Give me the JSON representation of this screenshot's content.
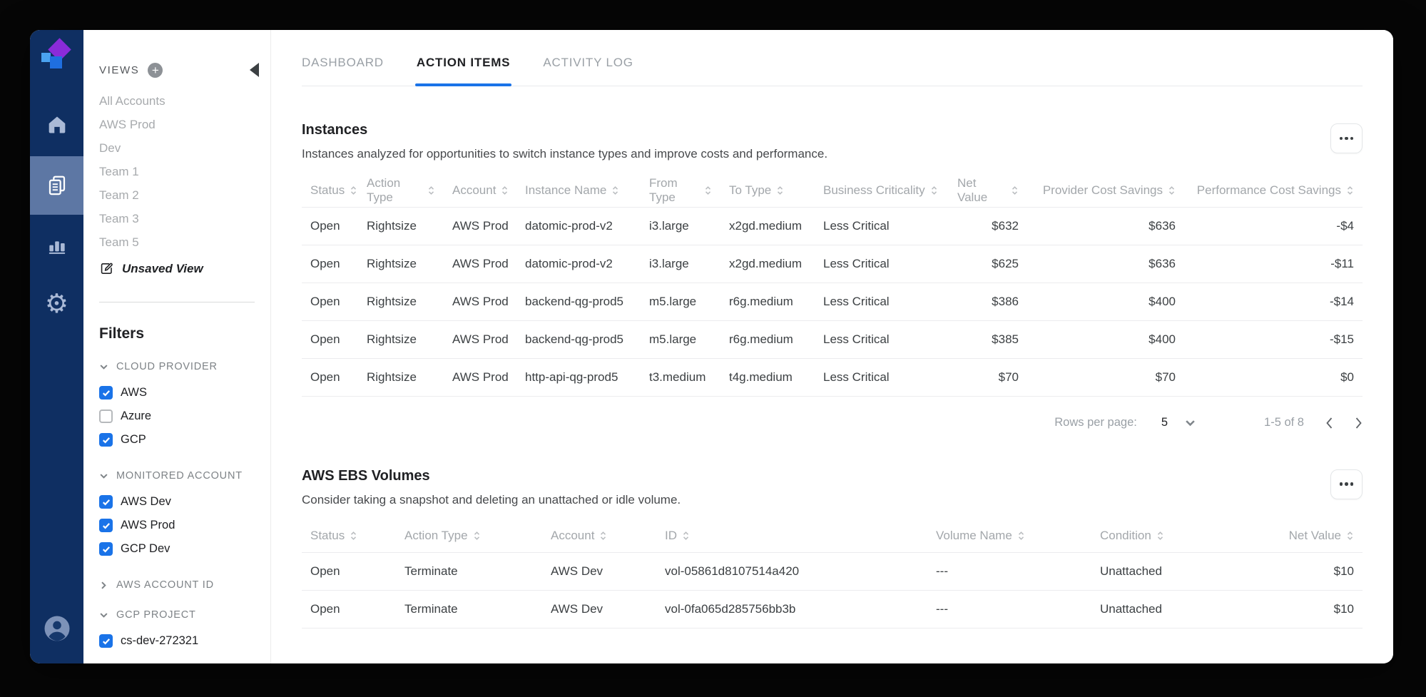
{
  "colors": {
    "accent_blue": "#1a73e8",
    "rail_navy": "#0f2f62",
    "rail_active": "#5d77a4",
    "checkbox_blue": "#1a73e8",
    "logo_purple": "#8a2bd9",
    "logo_blue": "#1f6fe0",
    "logo_lightblue": "#4aa3f0"
  },
  "icons": [
    "home-icon",
    "pages-icon",
    "bar-chart-icon",
    "gear-icon",
    "user-avatar-icon",
    "add-view-icon",
    "collapse-sidebar-icon",
    "edit-icon",
    "chevron-down-icon",
    "chevron-right-icon",
    "sort-icon",
    "more-options-icon",
    "prev-page-icon",
    "next-page-icon"
  ],
  "sidebar": {
    "views_label": "VIEWS",
    "views": [
      "All Accounts",
      "AWS Prod",
      "Dev",
      "Team 1",
      "Team 2",
      "Team 3",
      "Team 5"
    ],
    "unsaved_view_label": "Unsaved View",
    "filters_title": "Filters",
    "filter_sections": [
      {
        "label": "CLOUD PROVIDER",
        "expanded": true,
        "options": [
          {
            "label": "AWS",
            "checked": true
          },
          {
            "label": "Azure",
            "checked": false
          },
          {
            "label": "GCP",
            "checked": true
          }
        ]
      },
      {
        "label": "MONITORED ACCOUNT",
        "expanded": true,
        "options": [
          {
            "label": "AWS Dev",
            "checked": true
          },
          {
            "label": "AWS Prod",
            "checked": true
          },
          {
            "label": "GCP Dev",
            "checked": true
          }
        ]
      },
      {
        "label": "AWS ACCOUNT ID",
        "expanded": false,
        "options": []
      },
      {
        "label": "GCP PROJECT",
        "expanded": true,
        "options": [
          {
            "label": "cs-dev-272321",
            "checked": true
          }
        ]
      }
    ]
  },
  "tabs": [
    {
      "label": "DASHBOARD",
      "active": false
    },
    {
      "label": "ACTION ITEMS",
      "active": true
    },
    {
      "label": "ACTIVITY LOG",
      "active": false
    }
  ],
  "instances": {
    "title": "Instances",
    "subtitle": "Instances analyzed for opportunities to switch instance types and improve costs and performance.",
    "columns": [
      "Status",
      "Action Type",
      "Account",
      "Instance Name",
      "From Type",
      "To Type",
      "Business Criticality",
      "Net Value",
      "Provider Cost Savings",
      "Performance Cost Savings"
    ],
    "rows": [
      [
        "Open",
        "Rightsize",
        "AWS Prod",
        "datomic-prod-v2",
        "i3.large",
        "x2gd.medium",
        "Less Critical",
        "$632",
        "$636",
        "-$4"
      ],
      [
        "Open",
        "Rightsize",
        "AWS Prod",
        "datomic-prod-v2",
        "i3.large",
        "x2gd.medium",
        "Less Critical",
        "$625",
        "$636",
        "-$11"
      ],
      [
        "Open",
        "Rightsize",
        "AWS Prod",
        "backend-qg-prod5",
        "m5.large",
        "r6g.medium",
        "Less Critical",
        "$386",
        "$400",
        "-$14"
      ],
      [
        "Open",
        "Rightsize",
        "AWS Prod",
        "backend-qg-prod5",
        "m5.large",
        "r6g.medium",
        "Less Critical",
        "$385",
        "$400",
        "-$15"
      ],
      [
        "Open",
        "Rightsize",
        "AWS Prod",
        "http-api-qg-prod5",
        "t3.medium",
        "t4g.medium",
        "Less Critical",
        "$70",
        "$70",
        "$0"
      ]
    ],
    "pagination": {
      "rows_per_page_label": "Rows per page:",
      "rows_per_page": "5",
      "range": "1-5 of 8"
    }
  },
  "ebs_volumes": {
    "title": "AWS EBS Volumes",
    "subtitle": "Consider taking a snapshot and deleting an unattached or idle volume.",
    "columns": [
      "Status",
      "Action Type",
      "Account",
      "ID",
      "Volume Name",
      "Condition",
      "Net Value"
    ],
    "rows": [
      [
        "Open",
        "Terminate",
        "AWS Dev",
        "vol-05861d8107514a420",
        "---",
        "Unattached",
        "$10"
      ],
      [
        "Open",
        "Terminate",
        "AWS Dev",
        "vol-0fa065d285756bb3b",
        "---",
        "Unattached",
        "$10"
      ]
    ]
  }
}
